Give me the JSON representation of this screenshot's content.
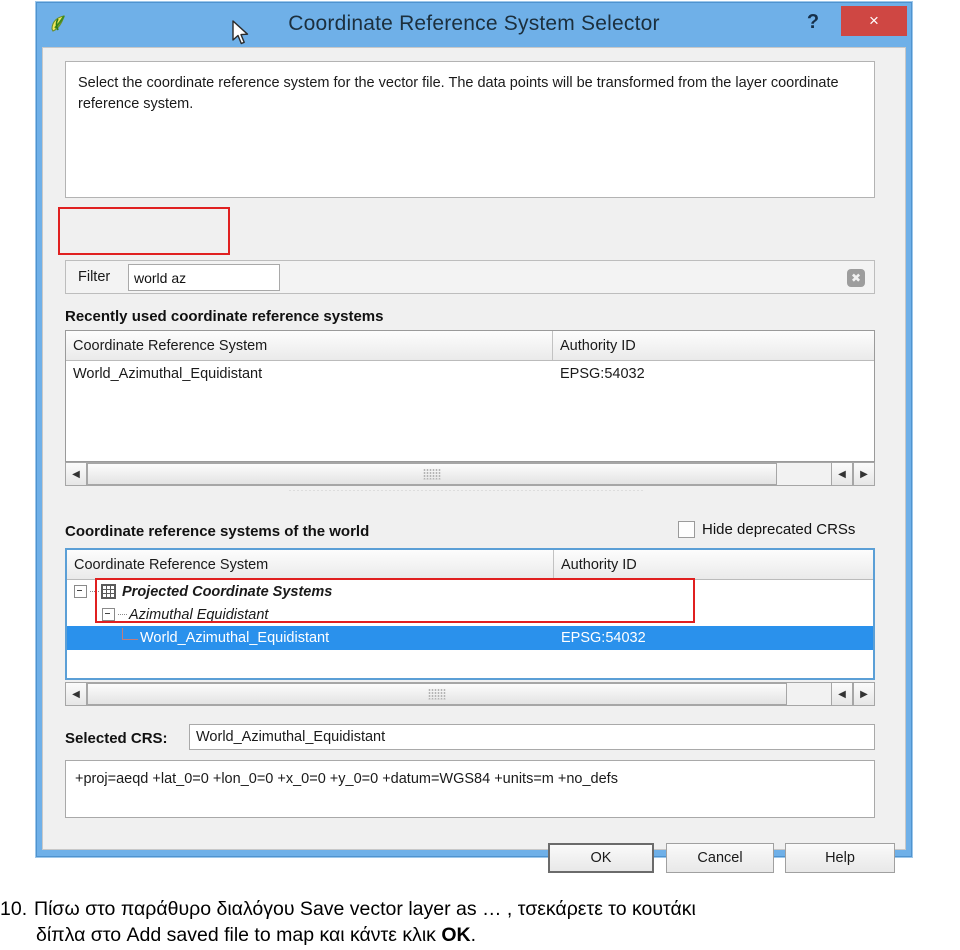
{
  "window": {
    "title": "Coordinate Reference System Selector",
    "app_icon": "qgis-leaf-icon",
    "help_button": "?",
    "close_button": "×",
    "titlebar_color": "#6FB0E8",
    "close_color": "#cf4743"
  },
  "description": "Select the coordinate reference system for the vector file. The data points will be transformed from the layer coordinate reference system.",
  "filter": {
    "label": "Filter",
    "value": "world az",
    "placeholder": "",
    "clear_icon": "clear-x-icon",
    "highlight_color": "#e02020"
  },
  "recent": {
    "title": "Recently used coordinate reference systems",
    "columns": [
      "Coordinate Reference System",
      "Authority ID"
    ],
    "rows": [
      {
        "crs": "World_Azimuthal_Equidistant",
        "authority": "EPSG:54032"
      }
    ]
  },
  "world": {
    "title": "Coordinate reference systems of the world",
    "hide_deprecated_label": "Hide deprecated CRSs",
    "hide_deprecated_checked": false,
    "columns": [
      "Coordinate Reference System",
      "Authority ID"
    ],
    "tree": [
      {
        "label": "Projected Coordinate Systems",
        "authority": "",
        "level": 0,
        "expanded": true,
        "icon": "grid-icon",
        "selected": false
      },
      {
        "label": "Azimuthal Equidistant",
        "authority": "",
        "level": 1,
        "expanded": true,
        "icon": "",
        "selected": false
      },
      {
        "label": "World_Azimuthal_Equidistant",
        "authority": "EPSG:54032",
        "level": 2,
        "expanded": false,
        "icon": "",
        "selected": true
      }
    ],
    "selection_color": "#2a91ec"
  },
  "selected_crs": {
    "label": "Selected CRS:",
    "value": "World_Azimuthal_Equidistant",
    "proj_string": "+proj=aeqd +lat_0=0 +lon_0=0 +x_0=0 +y_0=0 +datum=WGS84 +units=m +no_defs"
  },
  "buttons": {
    "ok": "OK",
    "cancel": "Cancel",
    "help": "Help"
  },
  "scrollbars": {
    "left_arrow": "◀",
    "right_arrow": "▶"
  },
  "caption": {
    "number": "10.",
    "line1_part1": "Πίσω στο παράθυρο διαλόγου Save vector layer as … , τσεκάρετε το κουτάκι",
    "line2_part1": "δίπλα στο Add saved file to map και κάντε κλικ ",
    "line2_bold": "OK",
    "line2_part2": "."
  }
}
